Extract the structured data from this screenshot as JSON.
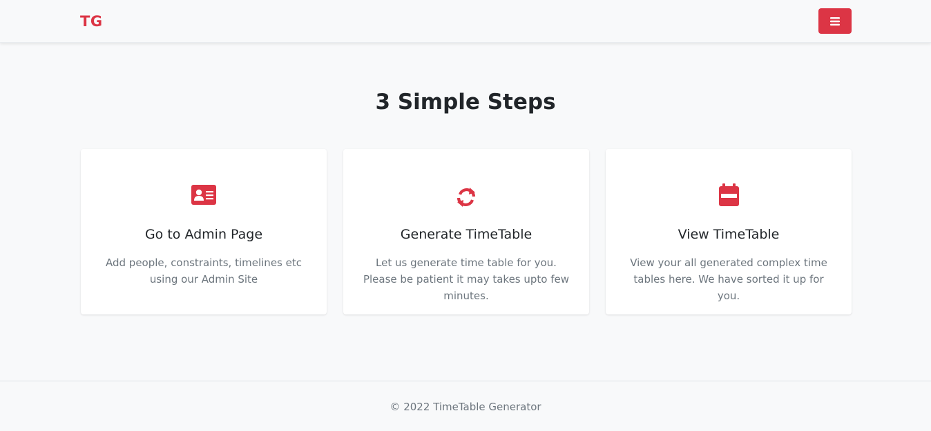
{
  "navbar": {
    "brand": "TG",
    "menu_icon": "hamburger-menu-icon"
  },
  "main": {
    "title": "3 Simple Steps",
    "cards": [
      {
        "icon": "id-card-icon",
        "title": "Go to Admin Page",
        "text": "Add people, constraints, timelines etc using our Admin Site"
      },
      {
        "icon": "sync-arrows-icon",
        "title": "Generate TimeTable",
        "text": "Let us generate time table for you. Please be patient it may takes upto few minutes."
      },
      {
        "icon": "calendar-icon",
        "title": "View TimeTable",
        "text": "View your all generated complex time tables here. We have sorted it up for you."
      }
    ]
  },
  "footer": {
    "text": "© 2022 TimeTable Generator"
  },
  "colors": {
    "accent": "#dc3545",
    "background": "#f8f9fa",
    "muted_text": "#6c757d"
  }
}
